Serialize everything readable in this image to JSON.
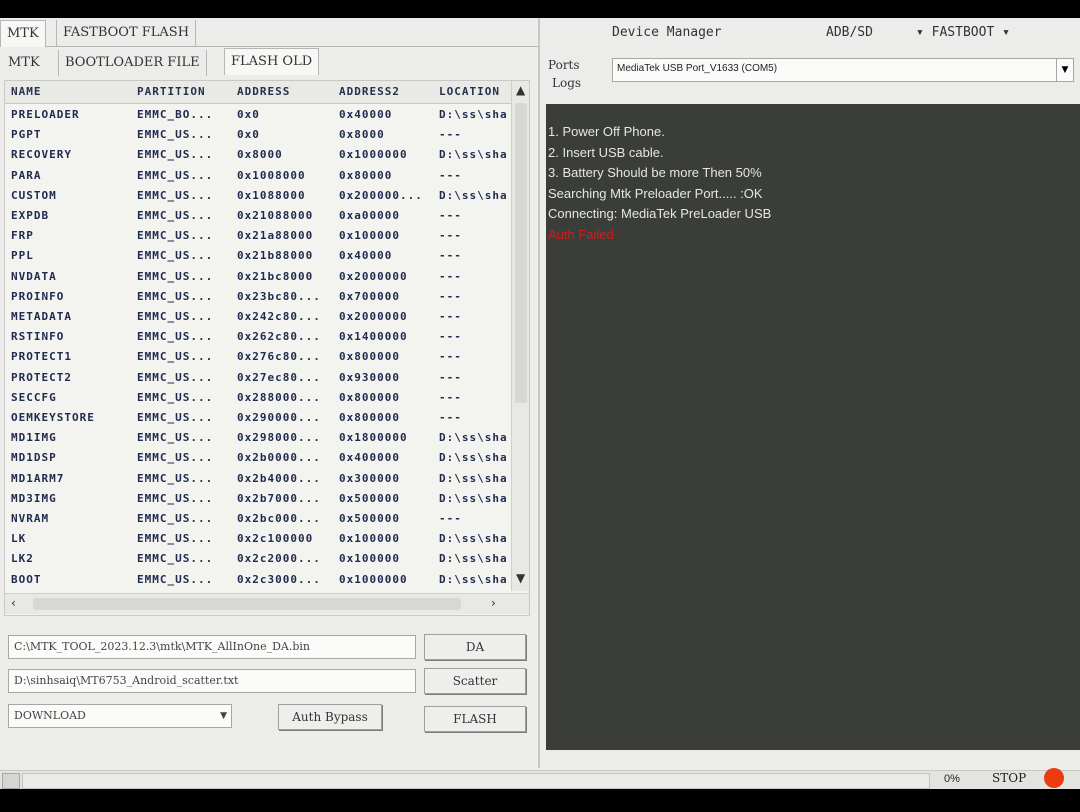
{
  "top_tabs": [
    "MTK",
    "FASTBOOT FLASH"
  ],
  "sub_tabs": [
    "MTK",
    "BOOTLOADER FILE",
    "FLASH OLD"
  ],
  "columns": [
    "NAME",
    "PARTITION",
    "ADDRESS",
    "ADDRESS2",
    "LOCATION"
  ],
  "rows": [
    [
      "PRELOADER",
      "EMMC_BO...",
      "0x0",
      "0x40000",
      "D:\\ss\\sha"
    ],
    [
      "PGPT",
      "EMMC_US...",
      "0x0",
      "0x8000",
      "---"
    ],
    [
      "RECOVERY",
      "EMMC_US...",
      "0x8000",
      "0x1000000",
      "D:\\ss\\sha"
    ],
    [
      "PARA",
      "EMMC_US...",
      "0x1008000",
      "0x80000",
      "---"
    ],
    [
      "CUSTOM",
      "EMMC_US...",
      "0x1088000",
      "0x200000...",
      "D:\\ss\\sha"
    ],
    [
      "EXPDB",
      "EMMC_US...",
      "0x21088000",
      "0xa00000",
      "---"
    ],
    [
      "FRP",
      "EMMC_US...",
      "0x21a88000",
      "0x100000",
      "---"
    ],
    [
      "PPL",
      "EMMC_US...",
      "0x21b88000",
      "0x40000",
      "---"
    ],
    [
      "NVDATA",
      "EMMC_US...",
      "0x21bc8000",
      "0x2000000",
      "---"
    ],
    [
      "PROINFO",
      "EMMC_US...",
      "0x23bc80...",
      "0x700000",
      "---"
    ],
    [
      "METADATA",
      "EMMC_US...",
      "0x242c80...",
      "0x2000000",
      "---"
    ],
    [
      "RSTINFO",
      "EMMC_US...",
      "0x262c80...",
      "0x1400000",
      "---"
    ],
    [
      "PROTECT1",
      "EMMC_US...",
      "0x276c80...",
      "0x800000",
      "---"
    ],
    [
      "PROTECT2",
      "EMMC_US...",
      "0x27ec80...",
      "0x930000",
      "---"
    ],
    [
      "SECCFG",
      "EMMC_US...",
      "0x288000...",
      "0x800000",
      "---"
    ],
    [
      "OEMKEYSTORE",
      "EMMC_US...",
      "0x290000...",
      "0x800000",
      "---"
    ],
    [
      "MD1IMG",
      "EMMC_US...",
      "0x298000...",
      "0x1800000",
      "D:\\ss\\sha"
    ],
    [
      "MD1DSP",
      "EMMC_US...",
      "0x2b0000...",
      "0x400000",
      "D:\\ss\\sha"
    ],
    [
      "MD1ARM7",
      "EMMC_US...",
      "0x2b4000...",
      "0x300000",
      "D:\\ss\\sha"
    ],
    [
      "MD3IMG",
      "EMMC_US...",
      "0x2b7000...",
      "0x500000",
      "D:\\ss\\sha"
    ],
    [
      "NVRAM",
      "EMMC_US...",
      "0x2bc000...",
      "0x500000",
      "---"
    ],
    [
      "LK",
      "EMMC_US...",
      "0x2c100000",
      "0x100000",
      "D:\\ss\\sha"
    ],
    [
      "LK2",
      "EMMC_US...",
      "0x2c2000...",
      "0x100000",
      "D:\\ss\\sha"
    ],
    [
      "BOOT",
      "EMMC_US...",
      "0x2c3000...",
      "0x1000000",
      "D:\\ss\\sha"
    ]
  ],
  "da_path": "C:\\MTK_TOOL_2023.12.3\\mtk\\MTK_AllInOne_DA.bin",
  "scatter_path": "D:\\sinhsaiq\\MT6753_Android_scatter.txt",
  "mode_select": "DOWNLOAD",
  "buttons": {
    "da": "DA",
    "scatter": "Scatter",
    "auth_bypass": "Auth Bypass",
    "flash": "FLASH",
    "stop": "STOP"
  },
  "right_tabs": [
    "Device Manager",
    "ADB/SD",
    "FASTBOOT"
  ],
  "ports_label": "Ports",
  "logs_label": "Logs",
  "port_value": "MediaTek USB Port_V1633 (COM5)",
  "logs": [
    {
      "text": "1. Power Off Phone.",
      "type": "normal"
    },
    {
      "text": "2. Insert USB cable.",
      "type": "normal"
    },
    {
      "text": "3. Battery Should be more Then 50%",
      "type": "normal"
    },
    {
      "text": "Searching Mtk Preloader Port.....          :OK",
      "type": "normal"
    },
    {
      "text": "Connecting: MediaTek PreLoader USB",
      "type": "normal"
    },
    {
      "text": "Auth Failed",
      "type": "error"
    }
  ],
  "progress_percent": "0%",
  "colors": {
    "logs_bg": "#3a3d39",
    "error": "#d21c1c",
    "stop_dot": "#ec3a13"
  }
}
